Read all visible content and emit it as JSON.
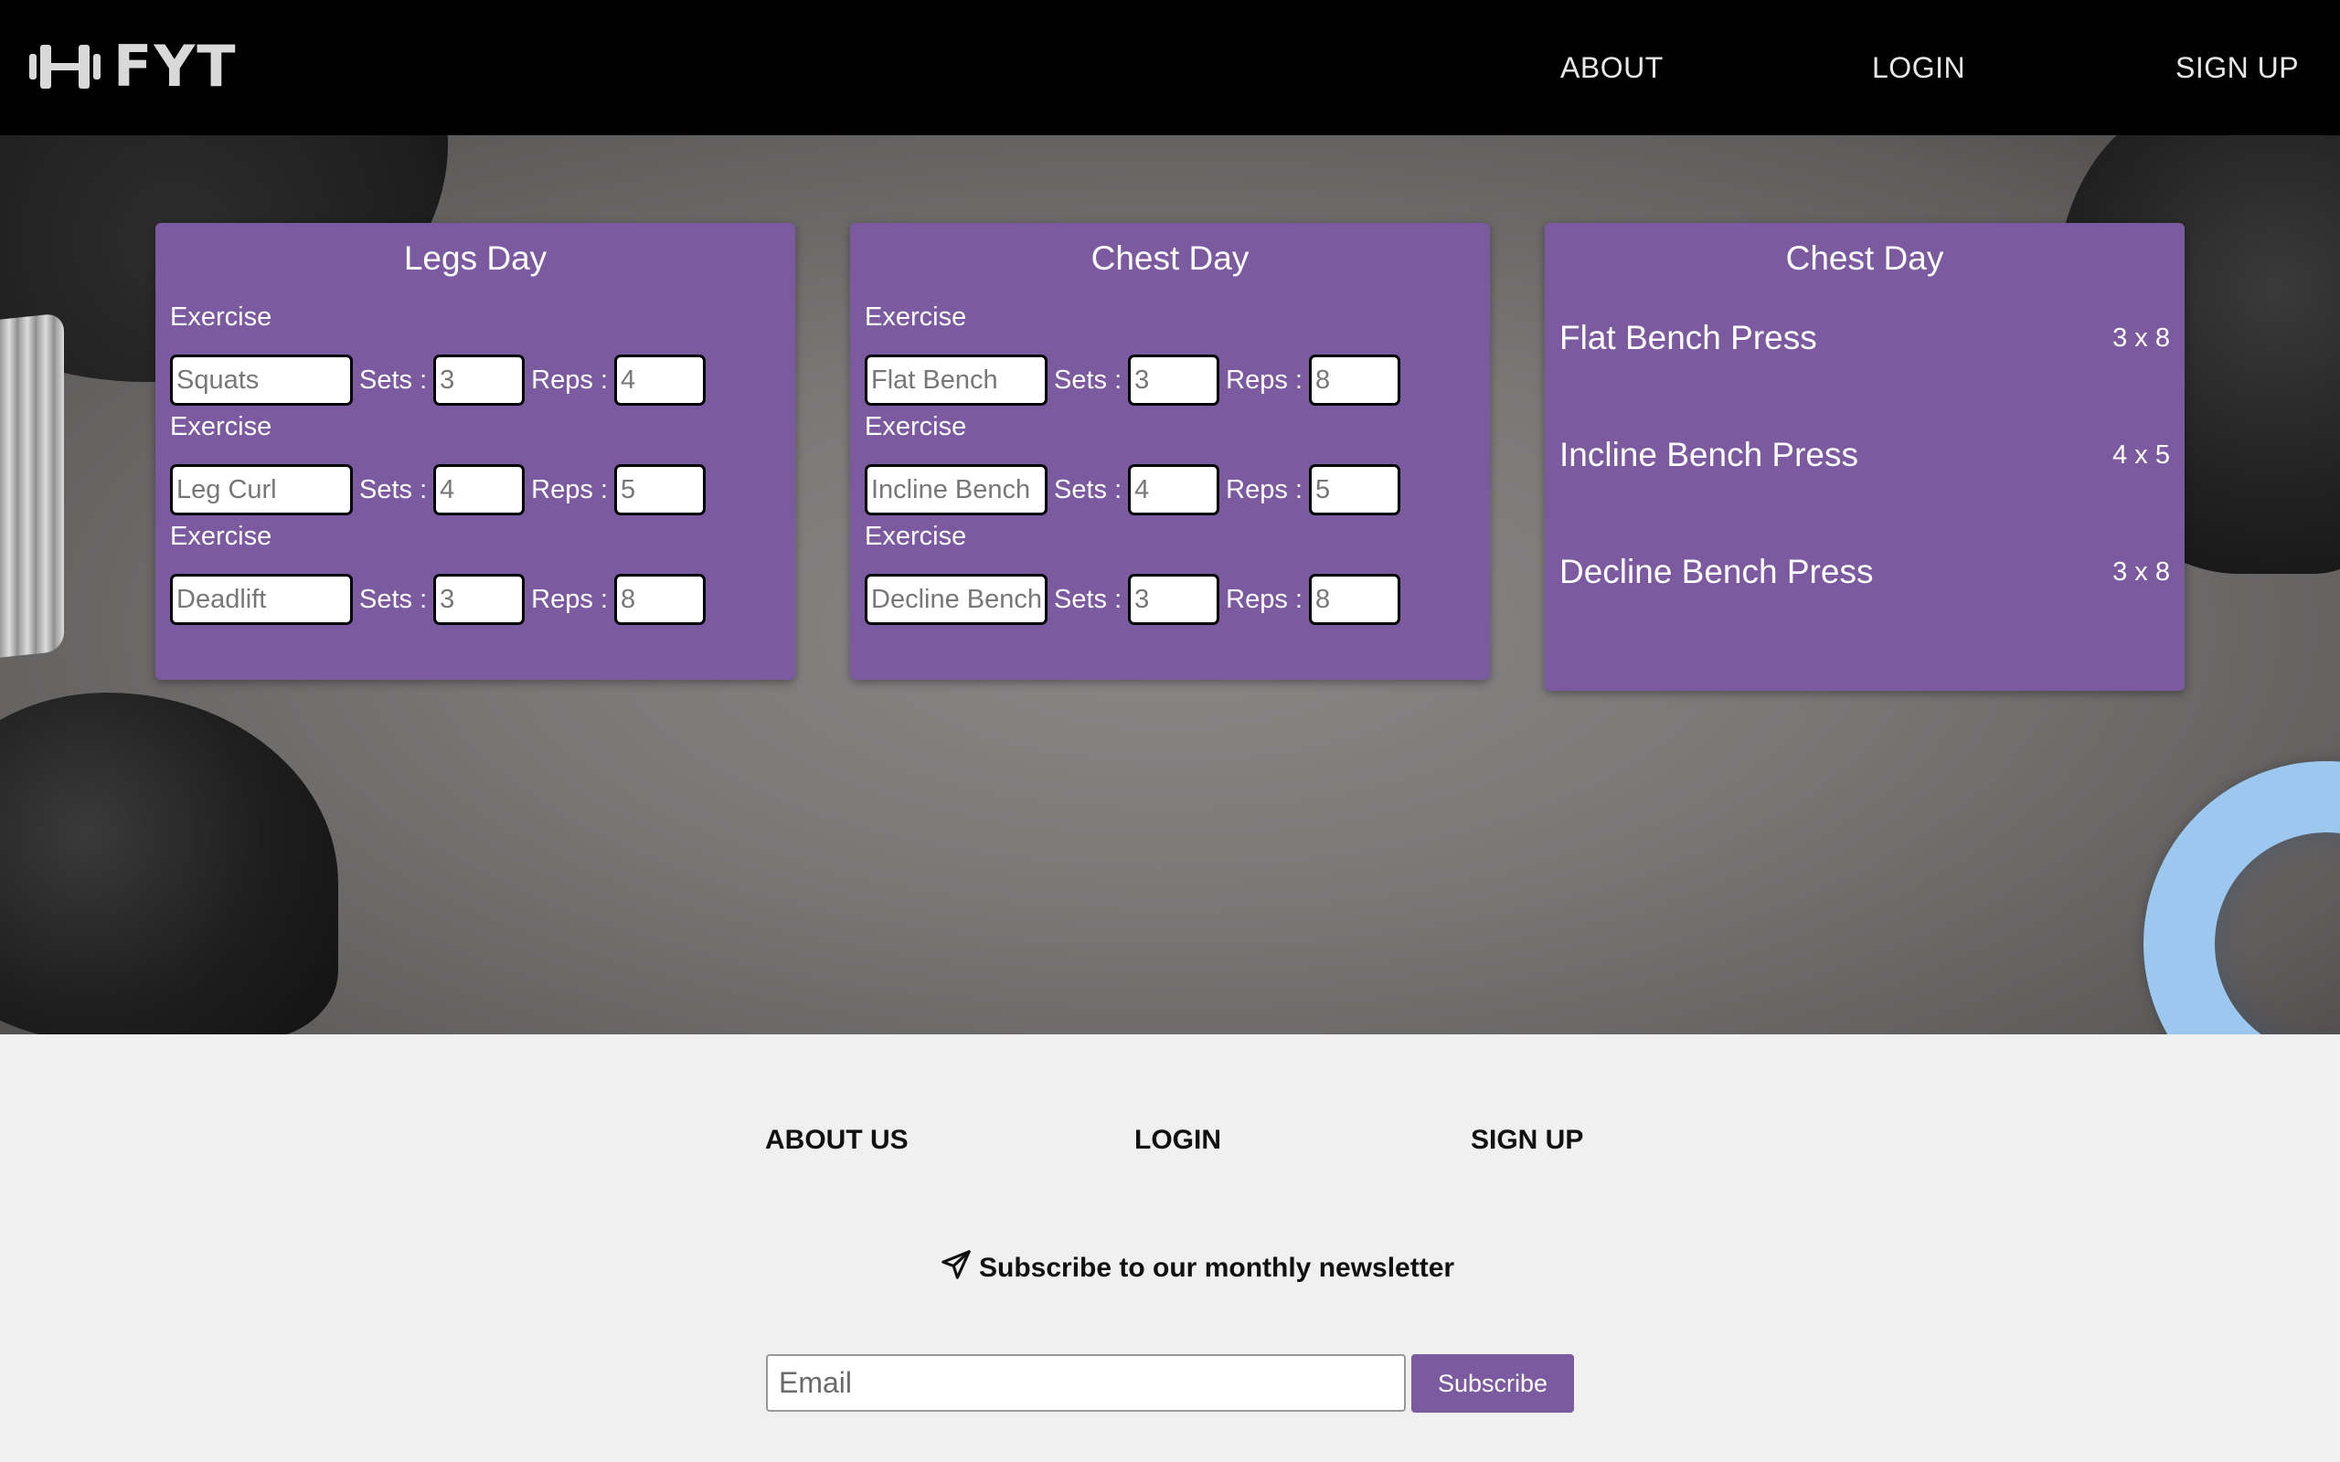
{
  "brand": {
    "name": "FYT",
    "logo_icon": "dumbbell-icon"
  },
  "nav": {
    "about": "ABOUT",
    "login": "LOGIN",
    "signup": "SIGN UP"
  },
  "colors": {
    "header_bg": "#000000",
    "card_bg": "#7b5aa0",
    "accent": "#7b5aa0",
    "footer_bg": "#f0f0f0"
  },
  "workout_cards": [
    {
      "title": "Legs Day",
      "exercise_label": "Exercise",
      "sets_label": "Sets :",
      "reps_label": "Reps :",
      "exercises": [
        {
          "name": "Squats",
          "sets": "3",
          "reps": "4"
        },
        {
          "name": "Leg Curl",
          "sets": "4",
          "reps": "5"
        },
        {
          "name": "Deadlift",
          "sets": "3",
          "reps": "8"
        }
      ]
    },
    {
      "title": "Chest Day",
      "exercise_label": "Exercise",
      "sets_label": "Sets :",
      "reps_label": "Reps :",
      "exercises": [
        {
          "name": "Flat Bench",
          "sets": "3",
          "reps": "8"
        },
        {
          "name": "Incline Bench",
          "sets": "4",
          "reps": "5"
        },
        {
          "name": "Decline Bench",
          "sets": "3",
          "reps": "8"
        }
      ]
    }
  ],
  "summary_card": {
    "title": "Chest Day",
    "items": [
      {
        "name": "Flat Bench Press",
        "sets_reps": "3 x 8"
      },
      {
        "name": "Incline Bench Press",
        "sets_reps": "4 x 5"
      },
      {
        "name": "Decline Bench Press",
        "sets_reps": "3 x 8"
      }
    ]
  },
  "footer": {
    "links": {
      "about": "ABOUT US",
      "login": "LOGIN",
      "signup": "SIGN UP"
    },
    "newsletter_text": "Subscribe to our monthly newsletter",
    "newsletter_icon": "paper-plane-icon",
    "email_placeholder": "Email",
    "subscribe_label": "Subscribe"
  }
}
